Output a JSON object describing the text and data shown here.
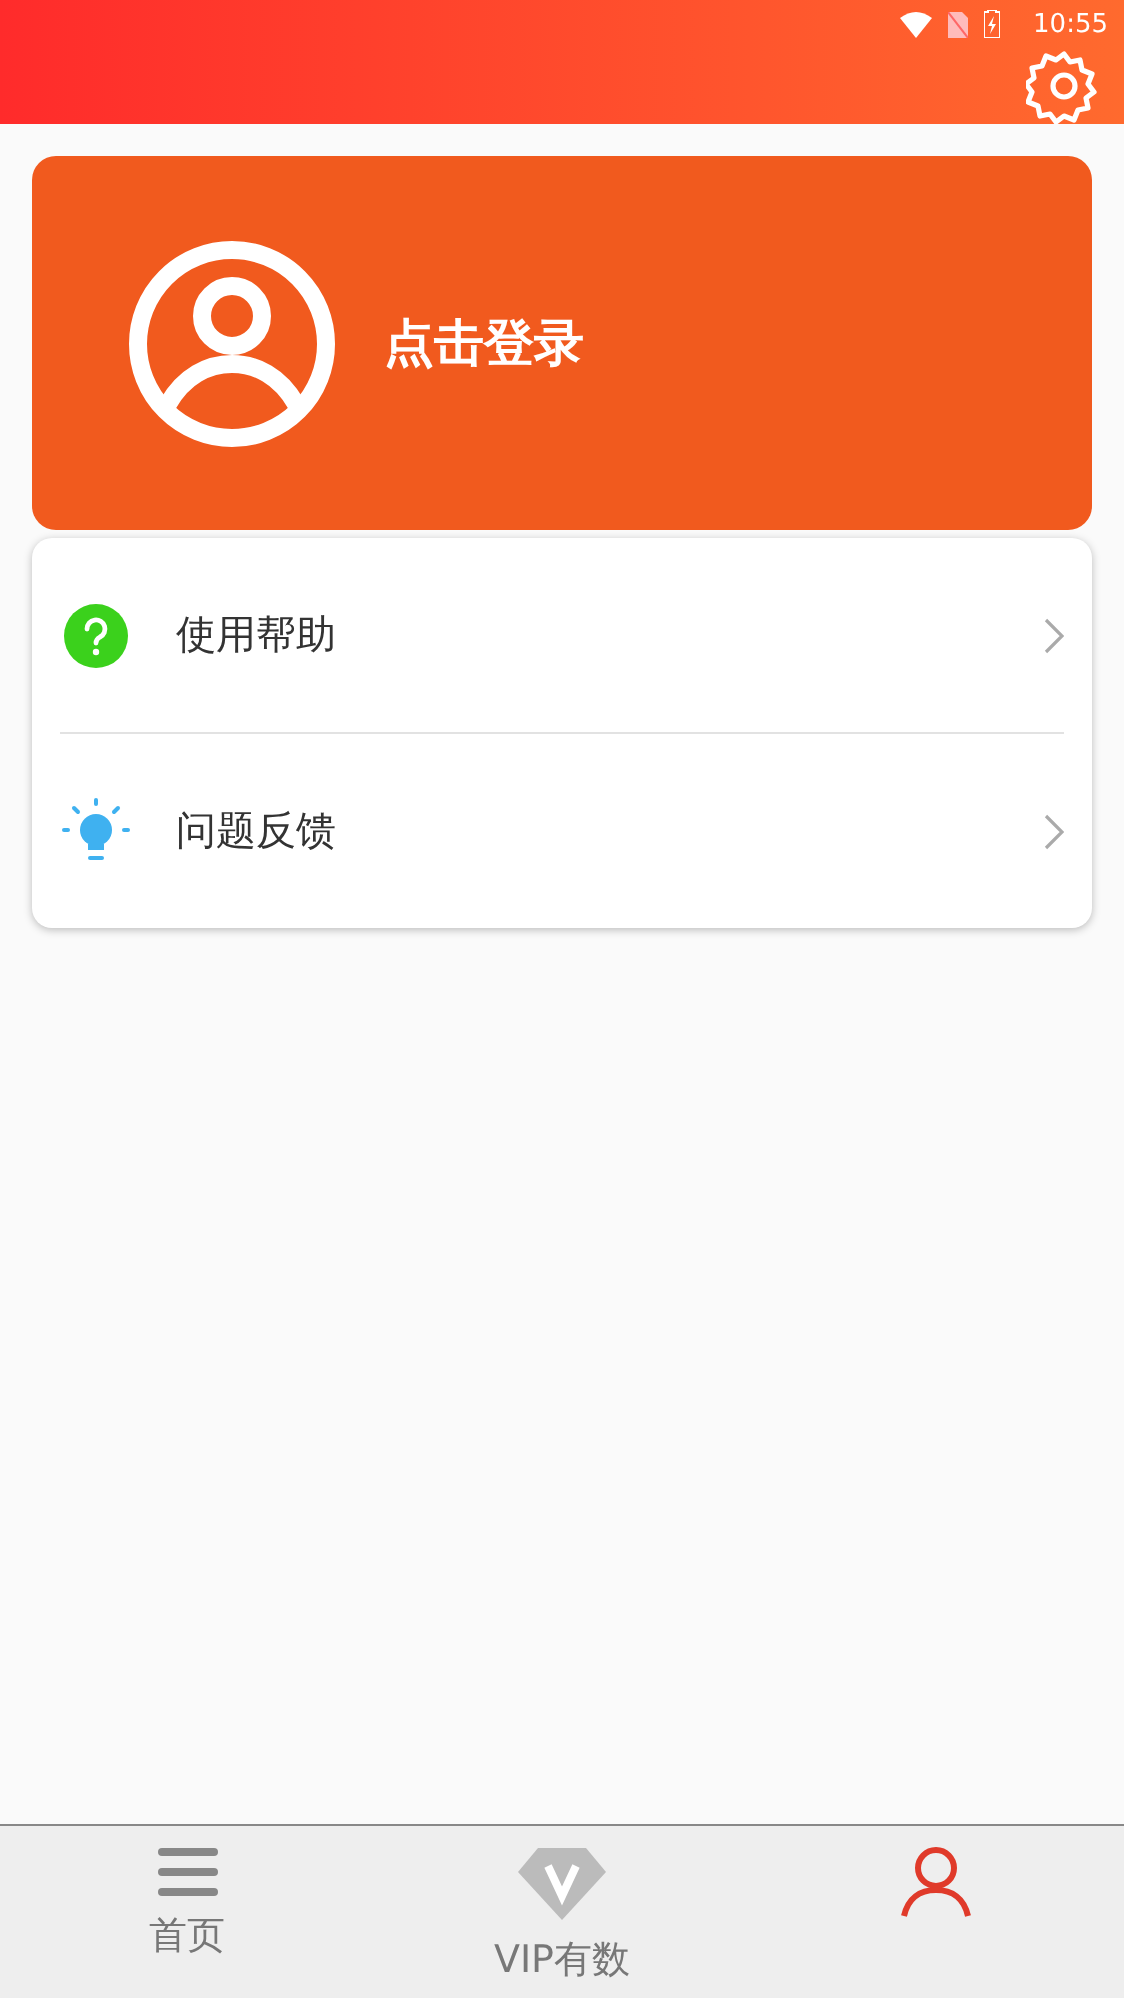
{
  "status_bar": {
    "time": "10:55"
  },
  "profile": {
    "login_label": "点击登录"
  },
  "menu": [
    {
      "kind": "help",
      "label": "使用帮助"
    },
    {
      "kind": "feedback",
      "label": "问题反馈"
    }
  ],
  "tabs": [
    {
      "kind": "menu",
      "label": "首页",
      "selected": false
    },
    {
      "kind": "vip",
      "label": "VIP有数",
      "selected": false
    },
    {
      "kind": "person",
      "selected": true
    }
  ]
}
